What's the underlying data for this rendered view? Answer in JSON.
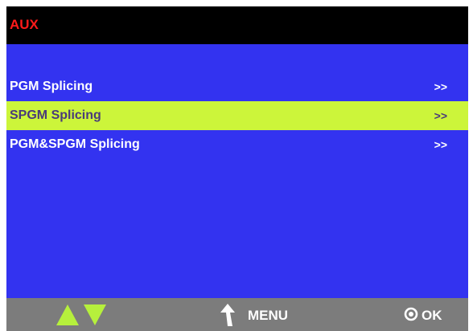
{
  "window": {
    "title": "AUX"
  },
  "menu": {
    "items": [
      {
        "label": "PGM Splicing",
        "arrow": ">>",
        "selected": false
      },
      {
        "label": "SPGM Splicing",
        "arrow": ">>",
        "selected": true
      },
      {
        "label": "PGM&SPGM Splicing",
        "arrow": ">>",
        "selected": false
      }
    ]
  },
  "footer": {
    "up_icon": "triangle-up-icon",
    "down_icon": "triangle-down-icon",
    "back_icon": "back-arrow-icon",
    "menu_label": "MENU",
    "ok_icon": "ring-icon",
    "ok_label": "OK"
  },
  "colors": {
    "background": "#3333f0",
    "title_bar": "#000000",
    "title_text": "#ff1a1a",
    "selected_row": "#ccf53a",
    "selected_text": "#4a3a7a",
    "footer": "#7c7c7c",
    "nav_arrows": "#b6f03c"
  }
}
